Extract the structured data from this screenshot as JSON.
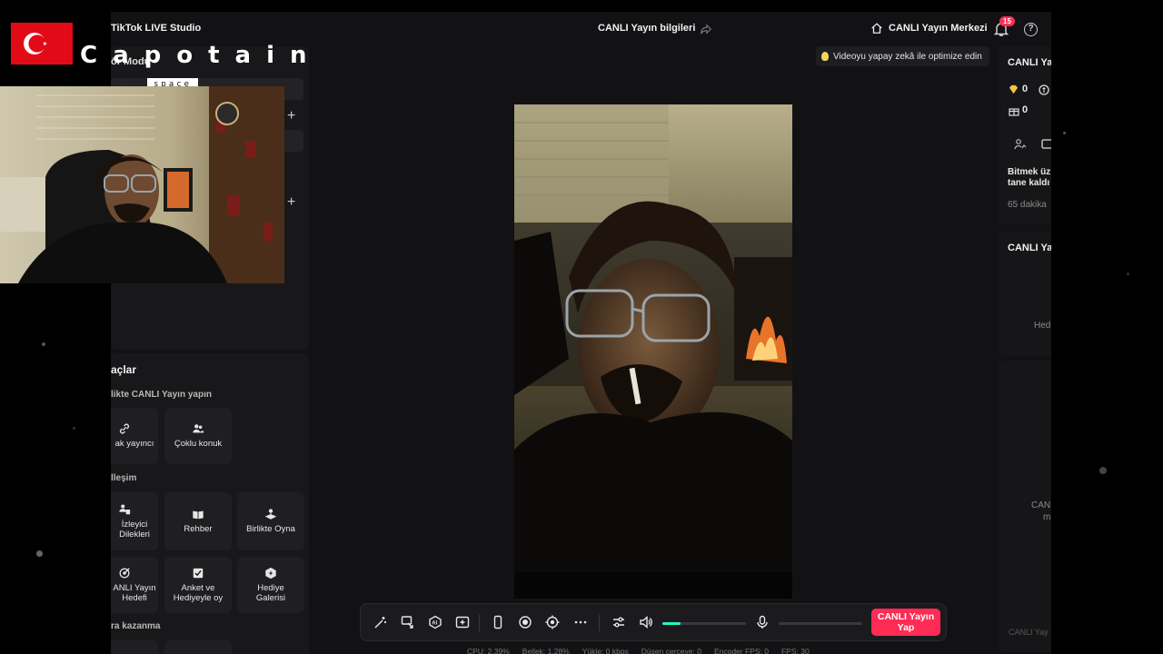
{
  "app": {
    "title": "TikTok LIVE Studio",
    "center_title": "CANLI Yayın bilgileri",
    "live_center": "CANLI Yayın Merkezi",
    "notification_count": "15",
    "help": "?"
  },
  "optimize_tip": "Videoyu yapay zekâ ile optimize edin",
  "left": {
    "scenes_title_fragment": "ör Modu",
    "tools_title": "açlar",
    "sections": {
      "together": "likte CANLI Yayın yapın",
      "interaction": "lleşim",
      "earn": "ra kazanma"
    },
    "tiles": [
      {
        "id": "cohost",
        "label": "ak yayıncı"
      },
      {
        "id": "multi",
        "label": "Çoklu konuk"
      },
      {
        "id": "requests",
        "label": "İzleyici\nDilekleri"
      },
      {
        "id": "guide",
        "label": "Rehber"
      },
      {
        "id": "play",
        "label": "Birlikte Oyna"
      },
      {
        "id": "goal",
        "label": "ANLI Yayın\nHedefi"
      },
      {
        "id": "poll",
        "label": "Anket ve\nHediyeyle oy"
      },
      {
        "id": "gallery",
        "label": "Hediye\nGalerisi"
      }
    ]
  },
  "right": {
    "card1_title": "CANLI Ya",
    "diamonds": "0",
    "gifts": "0",
    "finish_text_1": "Bitmek üz",
    "finish_text_2": "tane kaldı",
    "minutes": "65 dakika",
    "card2_title": "CANLI Yay",
    "gift_placeholder": "Hediye",
    "card3_line1": "CAN",
    "card3_line2": "m",
    "bottom_muted": "CANLI Yay"
  },
  "toolbar": {
    "go_live_line1": "CANLI Yayın",
    "go_live_line2": "Yap",
    "volume_level": 0.22,
    "mic_level": 0
  },
  "status": {
    "cpu": "CPU: 2.39%",
    "memory": "Bellek: 1.28%",
    "upload": "Yükle: 0 kbps",
    "dropped": "Düşen çerçeve: 0",
    "encoder_fps": "Encoder FPS: 0",
    "fps": "FPS: 30"
  },
  "overlay": {
    "name": "Capotain",
    "tag": "space"
  },
  "colors": {
    "accent": "#fe2c55",
    "teal": "#25f4c8",
    "panel": "#18181a"
  }
}
